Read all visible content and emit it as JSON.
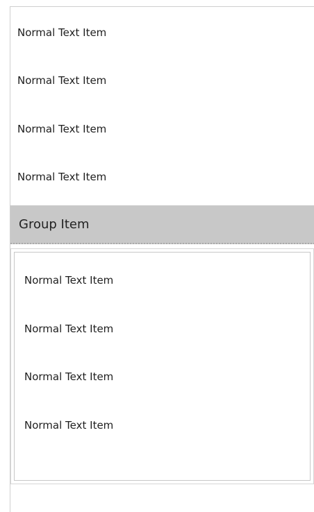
{
  "list": {
    "items": [
      {
        "label": "Normal Text Item"
      },
      {
        "label": "Normal Text Item"
      },
      {
        "label": "Normal Text Item"
      },
      {
        "label": "Normal Text Item"
      }
    ],
    "group": {
      "title": "Group Item",
      "items": [
        {
          "label": "Normal Text Item"
        },
        {
          "label": "Normal Text Item"
        },
        {
          "label": "Normal Text Item"
        },
        {
          "label": "Normal Text Item"
        }
      ]
    }
  },
  "colors": {
    "group_header_bg": "#c8c8c8",
    "border": "#cfcfcf",
    "text": "#1e1e1e"
  }
}
